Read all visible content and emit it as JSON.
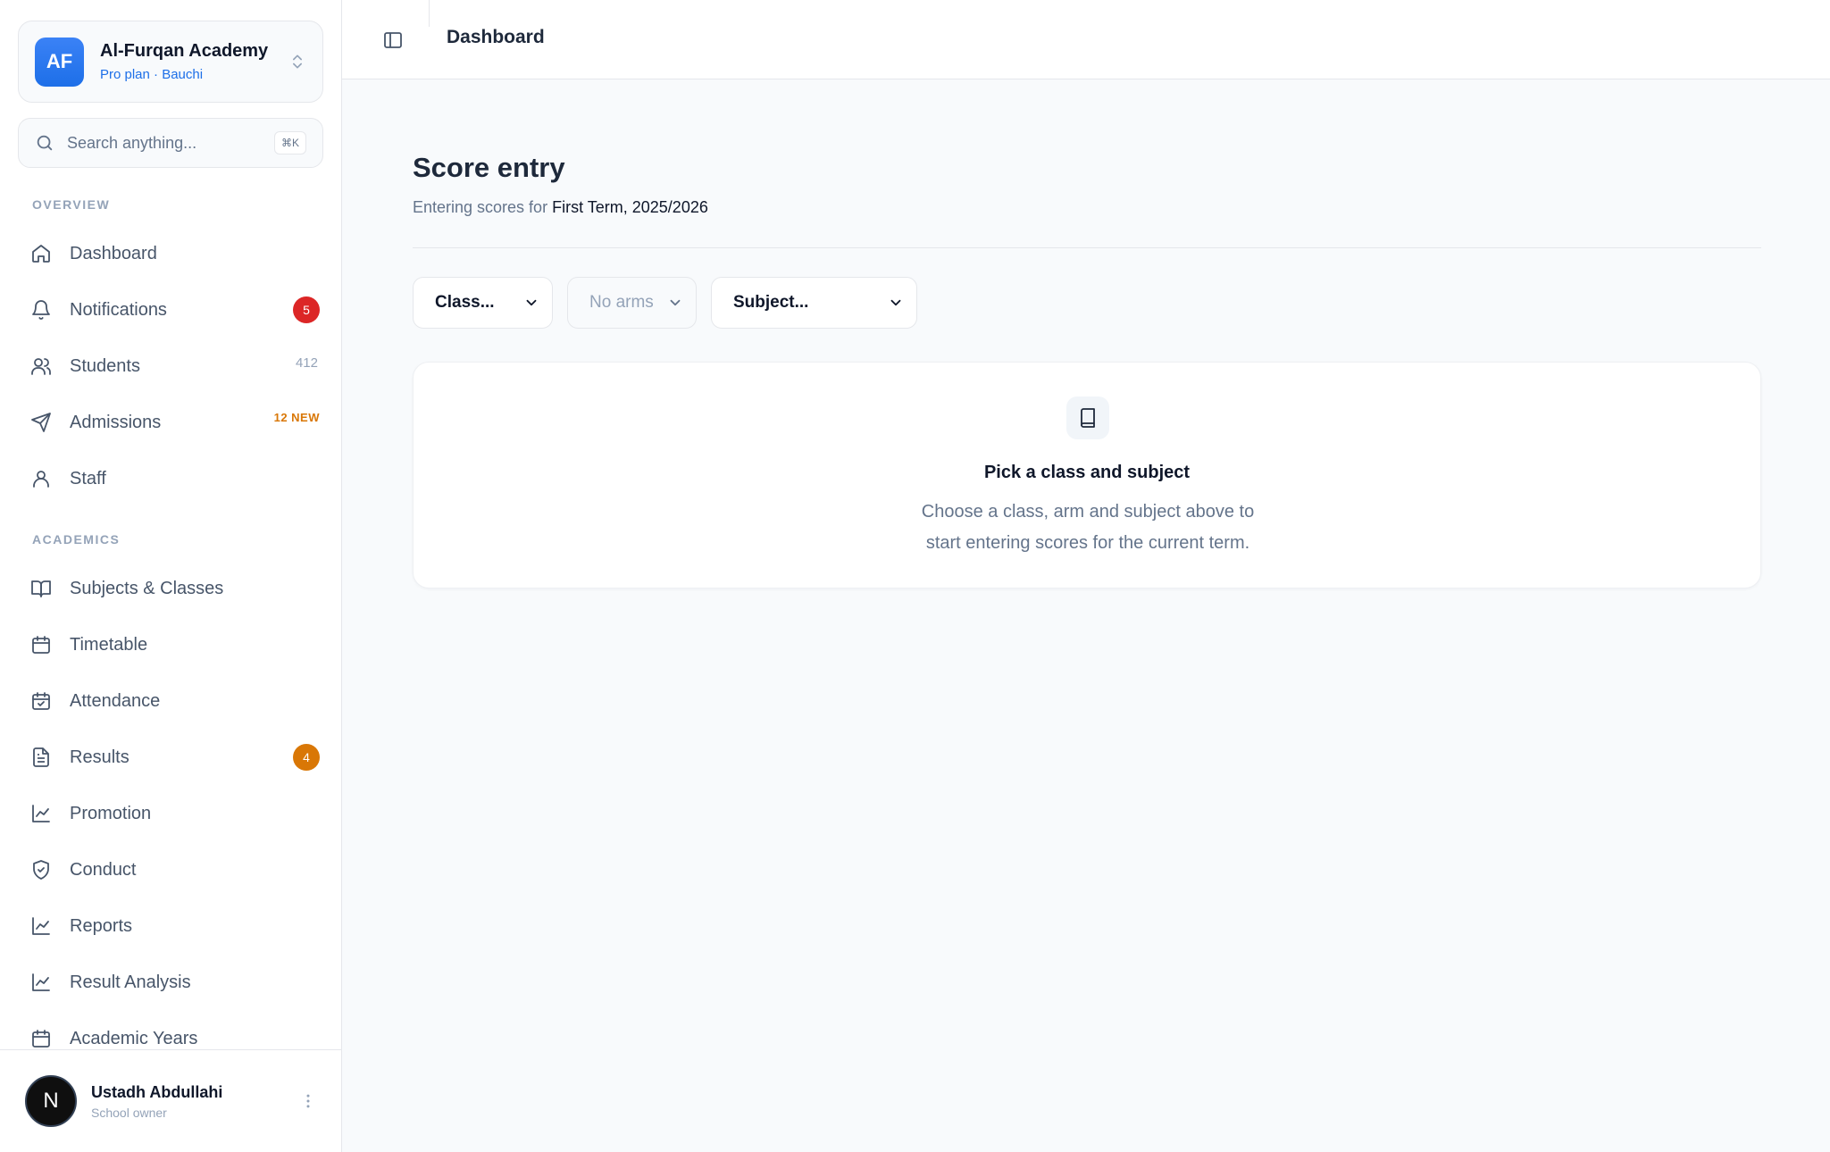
{
  "org": {
    "initials": "AF",
    "name": "Al-Furqan Academy",
    "plan": "Pro plan · Bauchi"
  },
  "search": {
    "placeholder": "Search anything...",
    "shortcut": "⌘K"
  },
  "sidebar": {
    "overview_label": "OVERVIEW",
    "academics_label": "ACADEMICS",
    "overview_items": [
      {
        "label": "Dashboard",
        "icon": "home-icon"
      },
      {
        "label": "Notifications",
        "icon": "bell-icon",
        "badge": "5"
      },
      {
        "label": "Students",
        "icon": "users-icon",
        "count": "412"
      },
      {
        "label": "Admissions",
        "icon": "send-icon",
        "tag": "12 NEW"
      },
      {
        "label": "Staff",
        "icon": "user-icon"
      }
    ],
    "academic_items": [
      {
        "label": "Subjects & Classes",
        "icon": "book-open-icon"
      },
      {
        "label": "Timetable",
        "icon": "calendar-icon"
      },
      {
        "label": "Attendance",
        "icon": "calendar-check-icon"
      },
      {
        "label": "Results",
        "icon": "file-text-icon",
        "badge": "4"
      },
      {
        "label": "Promotion",
        "icon": "chart-line-icon"
      },
      {
        "label": "Conduct",
        "icon": "shield-check-icon"
      },
      {
        "label": "Reports",
        "icon": "chart-line-icon"
      },
      {
        "label": "Result Analysis",
        "icon": "chart-line-icon"
      },
      {
        "label": "Academic Years",
        "icon": "calendar-icon"
      }
    ]
  },
  "user": {
    "initial": "N",
    "name": "Ustadh Abdullahi",
    "role": "School owner"
  },
  "header": {
    "breadcrumb": "Dashboard"
  },
  "page": {
    "title": "Score entry",
    "subtitle_prefix": "Entering scores for",
    "term": "First Term, 2025/2026"
  },
  "filters": {
    "class": "Class...",
    "arm": "No arms",
    "subject": "Subject..."
  },
  "empty_state": {
    "icon": "book-icon",
    "title": "Pick a class and subject",
    "line1": "Choose a class, arm and subject above to",
    "line2": "start entering scores for the current term."
  },
  "colors": {
    "accent": "#1d6fe8",
    "badge_red": "#dc2626",
    "badge_orange": "#d97706"
  }
}
